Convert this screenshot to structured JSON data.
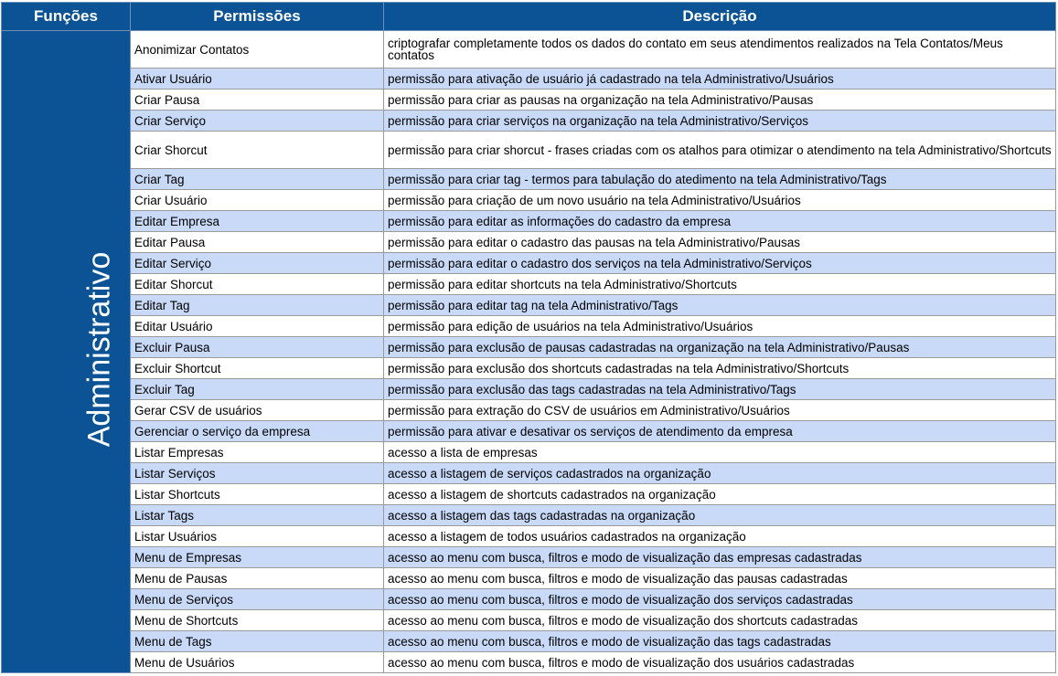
{
  "header": {
    "col_funcoes": "Funções",
    "col_permissoes": "Permissões",
    "col_descricao": "Descrição"
  },
  "group": {
    "label": "Administrativo"
  },
  "rows": [
    {
      "permission": "Anonimizar Contatos",
      "description": "criptografar completamente todos os dados do contato em seus atendimentos realizados na Tela Contatos/Meus contatos"
    },
    {
      "permission": "Ativar Usuário",
      "description": "permissão para ativação de usuário já cadastrado na tela Administrativo/Usuários"
    },
    {
      "permission": "Criar Pausa",
      "description": "permissão para criar as pausas na organização na tela Administrativo/Pausas"
    },
    {
      "permission": "Criar Serviço",
      "description": "permissão para criar serviços na organização na tela Administrativo/Serviços"
    },
    {
      "permission": "Criar Shorcut",
      "description": "permissão para criar shorcut - frases criadas com os atalhos para otimizar o atendimento na tela Administrativo/Shortcuts"
    },
    {
      "permission": "Criar Tag",
      "description": "permissão para criar tag - termos para tabulação do atedimento na tela Administrativo/Tags"
    },
    {
      "permission": "Criar Usuário",
      "description": "permissão para criação de um novo usuário na tela Administrativo/Usuários"
    },
    {
      "permission": "Editar Empresa",
      "description": "permissão para editar as informações do cadastro da empresa"
    },
    {
      "permission": "Editar Pausa",
      "description": "permissão para editar o cadastro das pausas na tela Administrativo/Pausas"
    },
    {
      "permission": "Editar Serviço",
      "description": "permissão para editar o cadastro dos serviços na tela Administrativo/Serviços"
    },
    {
      "permission": "Editar Shorcut",
      "description": "permissão para editar shortcuts  na tela Administrativo/Shortcuts"
    },
    {
      "permission": "Editar Tag",
      "description": "permissão para editar tag na tela Administrativo/Tags"
    },
    {
      "permission": "Editar Usuário",
      "description": "permissão para edição de usuários na tela Administrativo/Usuários"
    },
    {
      "permission": "Excluir Pausa",
      "description": "permissão para exclusão de pausas cadastradas na organização na tela Administrativo/Pausas"
    },
    {
      "permission": "Excluir Shortcut",
      "description": "permissão para exclusão dos shortcuts cadastradas na tela Administrativo/Shortcuts"
    },
    {
      "permission": "Excluir Tag",
      "description": "permissão para exclusão das tags cadastradas na tela Administrativo/Tags"
    },
    {
      "permission": "Gerar CSV de usuários",
      "description": "permissão para extração do CSV de usuários em Administrativo/Usuários"
    },
    {
      "permission": "Gerenciar o serviço da empresa",
      "description": "permissão para ativar e desativar os serviços de atendimento da empresa"
    },
    {
      "permission": "Listar Empresas",
      "description": "acesso a lista de empresas"
    },
    {
      "permission": "Listar Serviços",
      "description": "acesso a listagem de serviços cadastrados na organização"
    },
    {
      "permission": "Listar Shortcuts",
      "description": "acesso a listagem de shortcuts cadastrados na organização"
    },
    {
      "permission": "Listar Tags",
      "description": "acesso a listagem das tags cadastradas na organização"
    },
    {
      "permission": "Listar Usuários",
      "description": "acesso a listagem de todos usuários cadastrados na organização"
    },
    {
      "permission": "Menu de Empresas",
      "description": "acesso ao menu com busca, filtros e modo de visualização das empresas cadastradas"
    },
    {
      "permission": "Menu de Pausas",
      "description": "acesso ao menu com busca, filtros e modo de visualização das  pausas cadastradas"
    },
    {
      "permission": "Menu de Serviços",
      "description": "acesso ao menu com busca, filtros e modo de visualização dos serviços cadastradas"
    },
    {
      "permission": "Menu de Shortcuts",
      "description": "acesso ao menu com busca, filtros e modo de visualização dos shortcuts cadastradas"
    },
    {
      "permission": "Menu de Tags",
      "description": "acesso ao menu com busca, filtros e modo de visualização das  tags cadastradas"
    },
    {
      "permission": "Menu de Usuários",
      "description": "acesso ao menu com busca, filtros e modo de visualização dos usuários cadastradas"
    }
  ],
  "colors": {
    "header_bg": "#0b5394",
    "header_text": "#ffffff",
    "row_alt_bg": "#c9daf8",
    "row_bg": "#ffffff"
  }
}
